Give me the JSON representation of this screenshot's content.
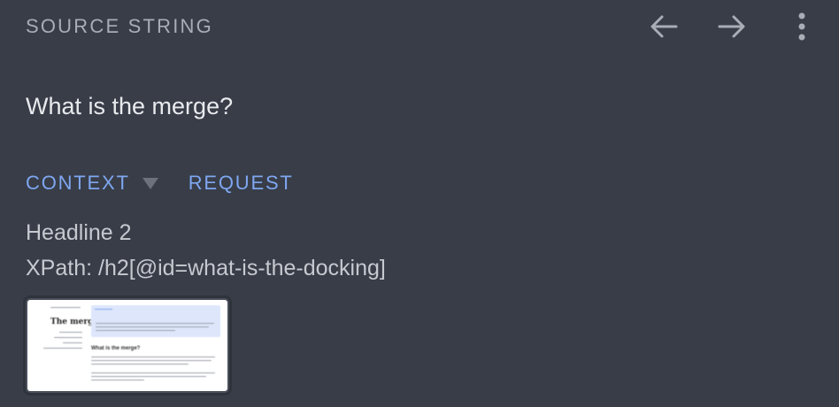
{
  "header": {
    "title": "SOURCE STRING",
    "back_icon": "arrow-left-icon",
    "forward_icon": "arrow-right-icon",
    "more_icon": "more-vertical-icon"
  },
  "source": {
    "text": "What is the merge?"
  },
  "tabs": [
    {
      "label": "CONTEXT",
      "has_dropdown": true
    },
    {
      "label": "REQUEST",
      "has_dropdown": false
    }
  ],
  "context": {
    "element_type": "Headline 2",
    "xpath": "XPath: /h2[@id=what-is-the-docking]"
  },
  "screenshot_thumbnail": {
    "page_title": "The merge",
    "heading": "What is the merge?"
  },
  "colors": {
    "background": "#383d48",
    "accent": "#7fa6f0",
    "muted_text": "#a9adb5"
  }
}
